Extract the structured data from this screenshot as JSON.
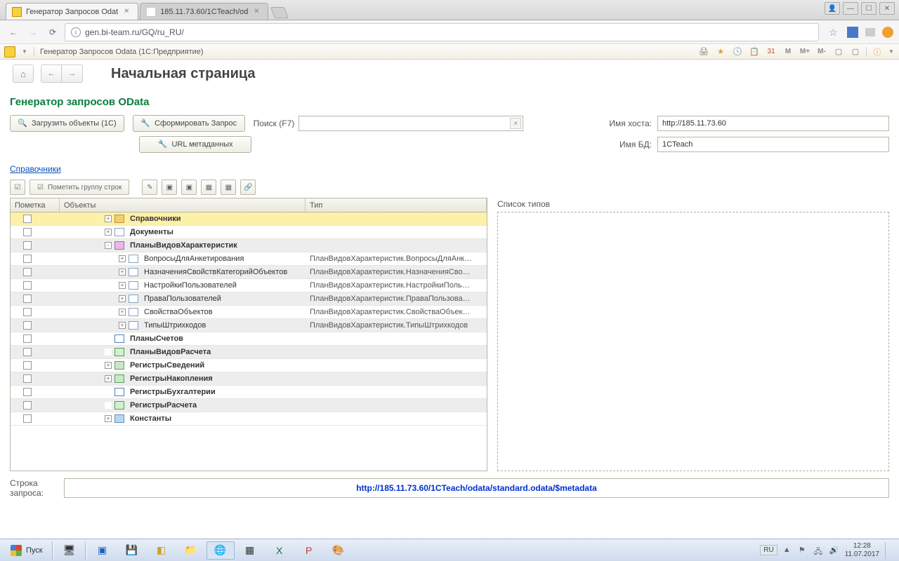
{
  "browser": {
    "tabs": [
      {
        "title": "Генератор Запросов Odat",
        "active": true,
        "favicon": "ic1c"
      },
      {
        "title": "185.11.73.60/1CTeach/od",
        "active": false,
        "favicon": "blank"
      }
    ],
    "url": "gen.bi-team.ru/GQ/ru_RU/"
  },
  "app_header": "Генератор Запросов Odata  (1С:Предприятие)",
  "toolbar_right": [
    "M",
    "M+",
    "M-"
  ],
  "page_title": "Начальная страница",
  "section_title": "Генератор запросов OData",
  "buttons": {
    "load": "Загрузить объекты (1С)",
    "form": "Сформировать Запрос",
    "meta": "URL метаданных",
    "mark_group": "Пометить группу строк"
  },
  "labels": {
    "search": "Поиск (F7)",
    "host": "Имя хоста:",
    "db": "Имя БД:",
    "types": "Список типов",
    "query_row": "Строка запроса:",
    "col_mark": "Пометка",
    "col_obj": "Объекты",
    "col_type": "Тип"
  },
  "fields": {
    "host": "http://185.11.73.60",
    "db": "1CTeach",
    "search": ""
  },
  "link_catalogs": "Справочники",
  "tree": [
    {
      "indent": 0,
      "exp": "+",
      "icon": "ic-folder",
      "name": "Справочники",
      "type": "",
      "bold": true,
      "sel": true,
      "alt": false
    },
    {
      "indent": 0,
      "exp": "+",
      "icon": "ic-doc",
      "name": "Документы",
      "type": "",
      "bold": true,
      "sel": false,
      "alt": false
    },
    {
      "indent": 0,
      "exp": "-",
      "icon": "ic-plan",
      "name": "ПланыВидовХарактеристик",
      "type": "",
      "bold": true,
      "sel": false,
      "alt": true
    },
    {
      "indent": 1,
      "exp": "+",
      "icon": "ic-doc",
      "name": "ВопросыДляАнкетирования",
      "type": "ПланВидовХарактеристик.ВопросыДляАнк…",
      "bold": false,
      "sel": false,
      "alt": false
    },
    {
      "indent": 1,
      "exp": "+",
      "icon": "ic-doc",
      "name": "НазначенияСвойствКатегорийОбъектов",
      "type": "ПланВидовХарактеристик.НазначенияСво…",
      "bold": false,
      "sel": false,
      "alt": true
    },
    {
      "indent": 1,
      "exp": "+",
      "icon": "ic-doc",
      "name": "НастройкиПользователей",
      "type": "ПланВидовХарактеристик.НастройкиПоль…",
      "bold": false,
      "sel": false,
      "alt": false
    },
    {
      "indent": 1,
      "exp": "+",
      "icon": "ic-doc",
      "name": "ПраваПользователей",
      "type": "ПланВидовХарактеристик.ПраваПользова…",
      "bold": false,
      "sel": false,
      "alt": true
    },
    {
      "indent": 1,
      "exp": "+",
      "icon": "ic-doc",
      "name": "СвойстваОбъектов",
      "type": "ПланВидовХарактеристик.СвойстваОбъек…",
      "bold": false,
      "sel": false,
      "alt": false
    },
    {
      "indent": 1,
      "exp": "+",
      "icon": "ic-doc",
      "name": "ТипыШтрихкодов",
      "type": "ПланВидовХарактеристик.ТипыШтрихкодов",
      "bold": false,
      "sel": false,
      "alt": true
    },
    {
      "indent": 0,
      "exp": " ",
      "icon": "ic-tt",
      "name": "ПланыСчетов",
      "type": "",
      "bold": true,
      "sel": false,
      "alt": false
    },
    {
      "indent": 0,
      "exp": " ",
      "icon": "ic-calc",
      "name": "ПланыВидовРасчета",
      "type": "",
      "bold": true,
      "sel": false,
      "alt": true
    },
    {
      "indent": 0,
      "exp": "+",
      "icon": "ic-reg",
      "name": "РегистрыСведений",
      "type": "",
      "bold": true,
      "sel": false,
      "alt": false
    },
    {
      "indent": 0,
      "exp": "+",
      "icon": "ic-reg",
      "name": "РегистрыНакопления",
      "type": "",
      "bold": true,
      "sel": false,
      "alt": true
    },
    {
      "indent": 0,
      "exp": " ",
      "icon": "ic-tt",
      "name": "РегистрыБухгалтерии",
      "type": "",
      "bold": true,
      "sel": false,
      "alt": false
    },
    {
      "indent": 0,
      "exp": " ",
      "icon": "ic-calc",
      "name": "РегистрыРасчета",
      "type": "",
      "bold": true,
      "sel": false,
      "alt": true
    },
    {
      "indent": 0,
      "exp": "+",
      "icon": "ic-const",
      "name": "Константы",
      "type": "",
      "bold": true,
      "sel": false,
      "alt": false
    }
  ],
  "result_url": "http://185.11.73.60/1CTeach/odata/standard.odata/$metadata",
  "taskbar": {
    "start": "Пуск",
    "lang": "RU",
    "time": "12:28",
    "date": "11.07.2017"
  }
}
